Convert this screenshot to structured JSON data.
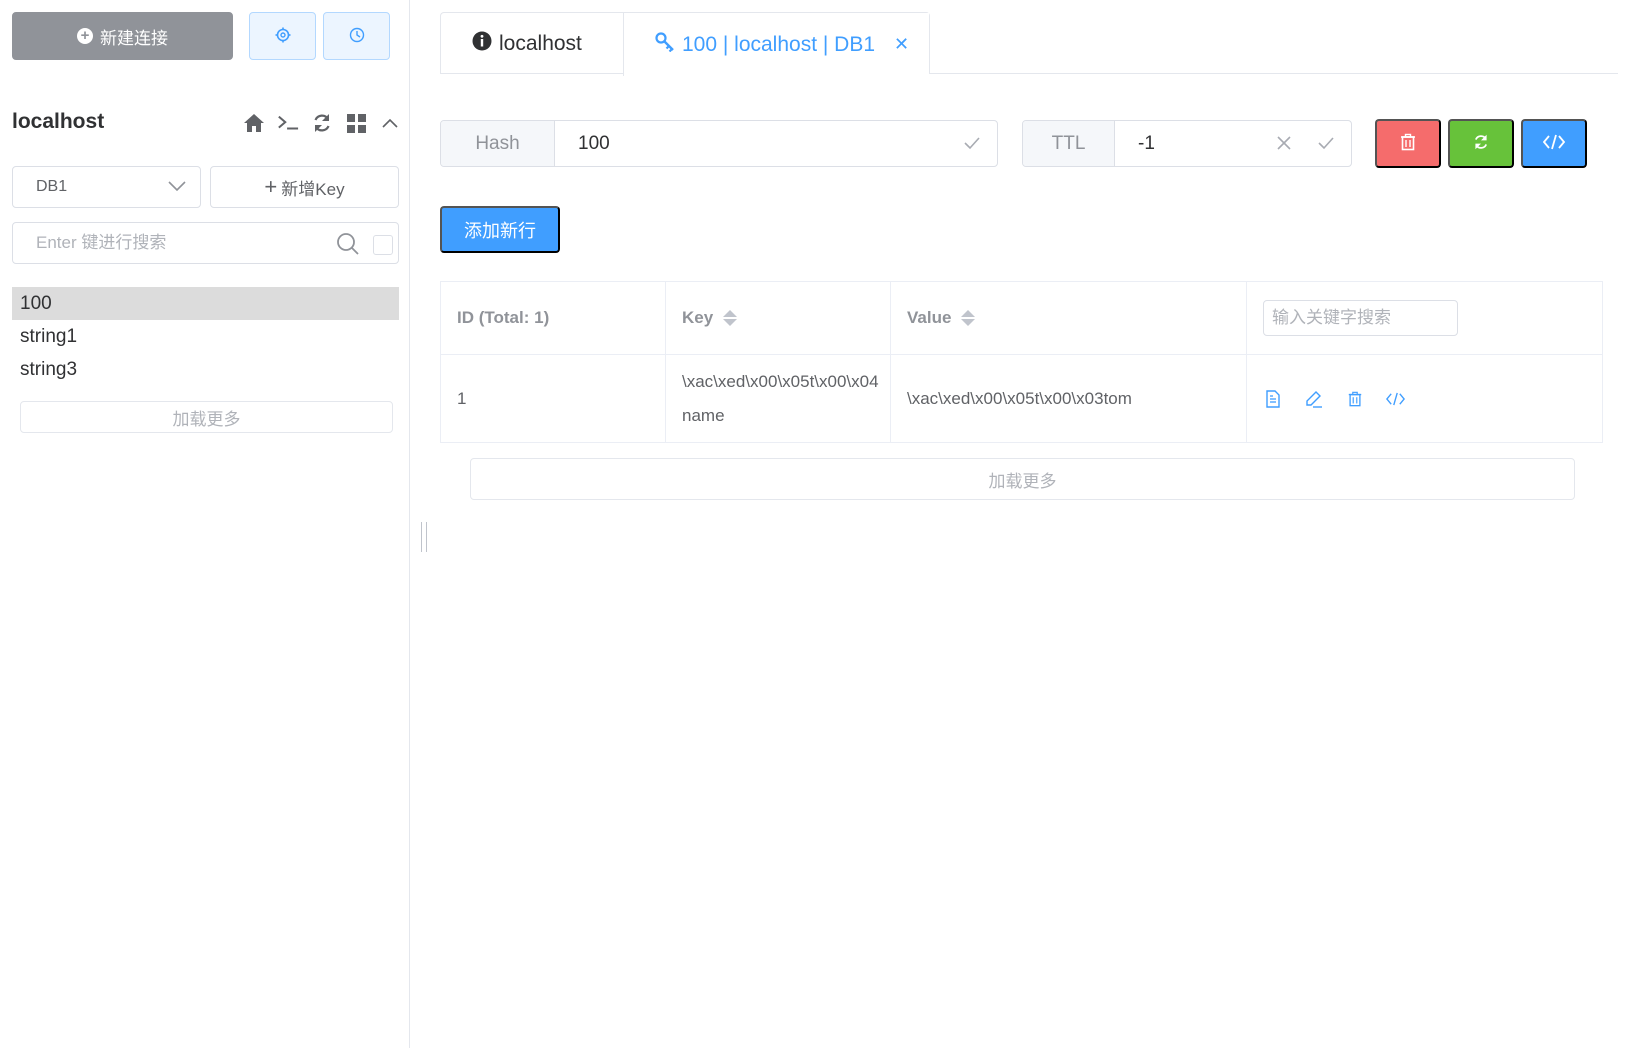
{
  "sidebar": {
    "new_connection_label": "新建连接",
    "connection_name": "localhost",
    "db_select": {
      "selected": "DB1"
    },
    "add_key_label": "新增Key",
    "search": {
      "placeholder": "Enter 键进行搜索"
    },
    "keys": [
      {
        "name": "100",
        "active": true
      },
      {
        "name": "string1",
        "active": false
      },
      {
        "name": "string3",
        "active": false
      }
    ],
    "load_more_label": "加载更多"
  },
  "tabs": [
    {
      "label": "localhost",
      "icon": "info-icon"
    },
    {
      "label": "100 | localhost | DB1",
      "icon": "key-icon",
      "active": true
    }
  ],
  "key_detail": {
    "type_label": "Hash",
    "key_name": "100",
    "ttl_label": "TTL",
    "ttl_value": "-1",
    "add_row_label": "添加新行",
    "table": {
      "headers": {
        "id": "ID (Total: 1)",
        "key": "Key",
        "value": "Value"
      },
      "search_placeholder": "输入关键字搜索",
      "rows": [
        {
          "id": "1",
          "key": "\\xac\\xed\\x00\\x05t\\x00\\x04name",
          "value": "\\xac\\xed\\x00\\x05t\\x00\\x03tom"
        }
      ]
    },
    "load_more_label": "加载更多"
  },
  "colors": {
    "primary": "#409eff",
    "danger": "#f56c6c",
    "success": "#67c23a",
    "info": "#909399"
  }
}
